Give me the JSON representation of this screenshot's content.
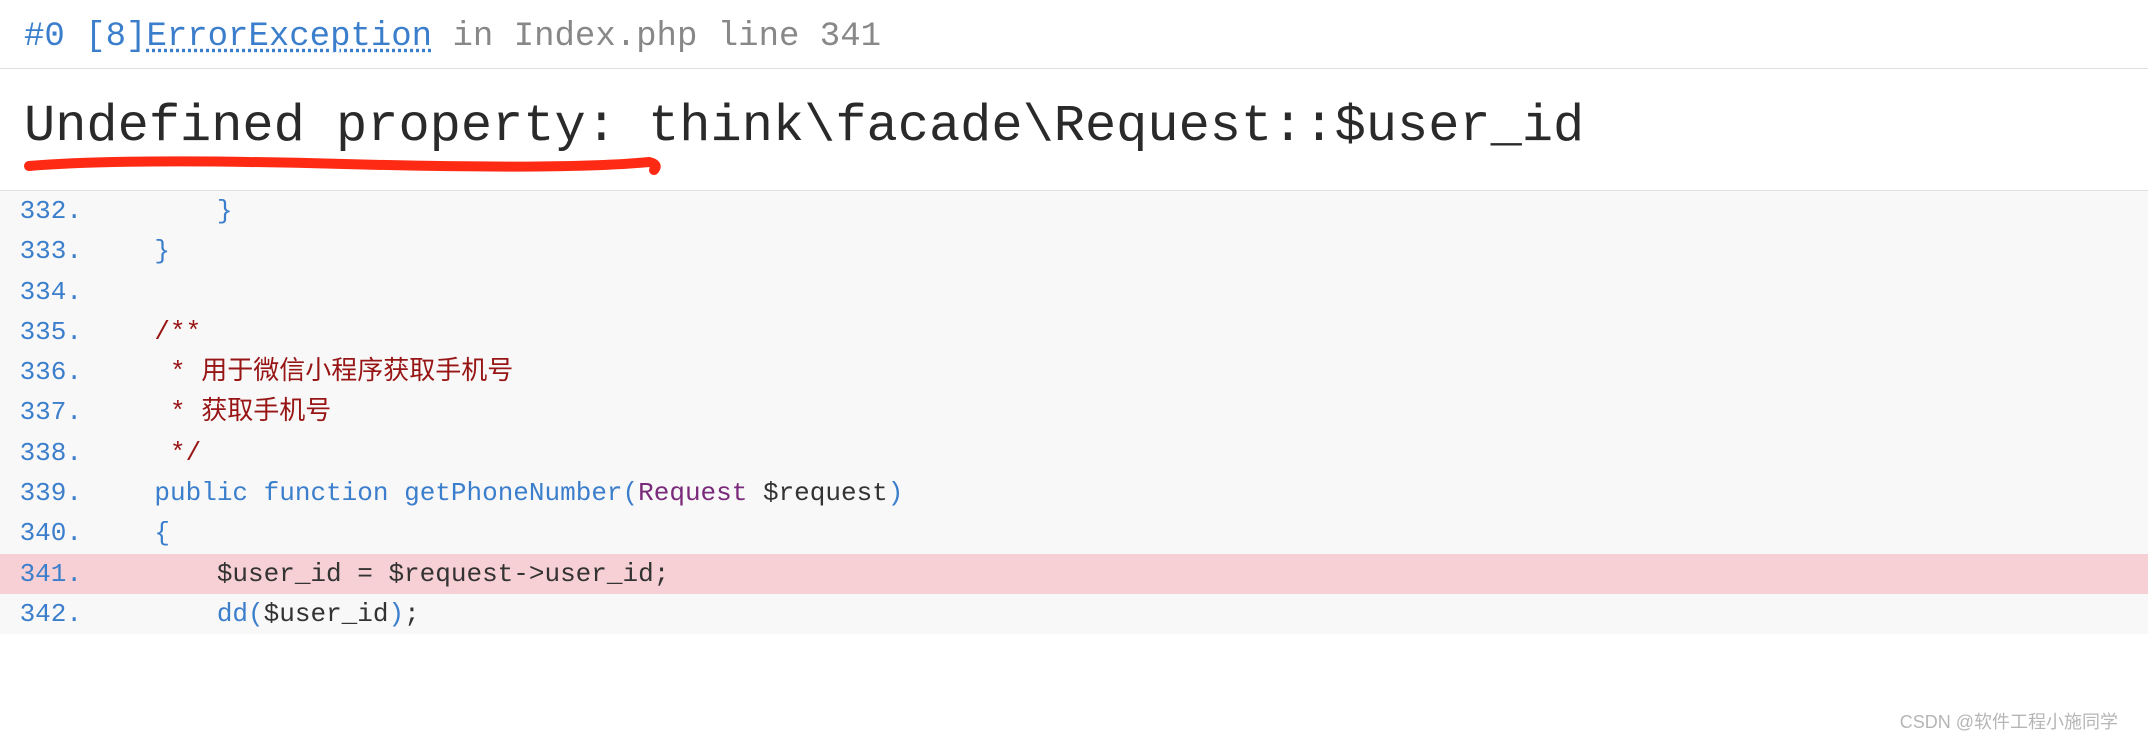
{
  "header": {
    "frame": "#0",
    "error_code_bracket_open": "[",
    "error_code": "8",
    "error_code_bracket_close": "]",
    "error_name": "ErrorException",
    "in": "in",
    "file": "Index.php",
    "line_word": "line",
    "line_number": "341"
  },
  "message": "Undefined property: think\\facade\\Request::$user_id",
  "code": {
    "lines": [
      {
        "n": "332.",
        "html": [
          {
            "c": "brace",
            "t": "        }"
          }
        ]
      },
      {
        "n": "333.",
        "html": [
          {
            "c": "brace",
            "t": "    }"
          }
        ]
      },
      {
        "n": "334.",
        "html": [
          {
            "c": "plain",
            "t": ""
          }
        ]
      },
      {
        "n": "335.",
        "html": [
          {
            "c": "comment",
            "t": "    /**"
          }
        ]
      },
      {
        "n": "336.",
        "html": [
          {
            "c": "comment",
            "t": "     * 用于微信小程序获取手机号"
          }
        ]
      },
      {
        "n": "337.",
        "html": [
          {
            "c": "comment",
            "t": "     * 获取手机号"
          }
        ]
      },
      {
        "n": "338.",
        "html": [
          {
            "c": "comment",
            "t": "     */"
          }
        ]
      },
      {
        "n": "339.",
        "html": [
          {
            "c": "plain",
            "t": "    "
          },
          {
            "c": "kw",
            "t": "public"
          },
          {
            "c": "plain",
            "t": " "
          },
          {
            "c": "kw",
            "t": "function"
          },
          {
            "c": "plain",
            "t": " "
          },
          {
            "c": "fn",
            "t": "getPhoneNumber"
          },
          {
            "c": "sym",
            "t": "("
          },
          {
            "c": "cls",
            "t": "Request"
          },
          {
            "c": "plain",
            "t": " $request"
          },
          {
            "c": "sym",
            "t": ")"
          }
        ]
      },
      {
        "n": "340.",
        "html": [
          {
            "c": "brace",
            "t": "    {"
          }
        ]
      },
      {
        "n": "341.",
        "highlight": true,
        "html": [
          {
            "c": "plain",
            "t": "        $user_id = $request->user_id;"
          }
        ]
      },
      {
        "n": "342.",
        "html": [
          {
            "c": "plain",
            "t": "        "
          },
          {
            "c": "fn",
            "t": "dd"
          },
          {
            "c": "sym",
            "t": "("
          },
          {
            "c": "plain",
            "t": "$user_id"
          },
          {
            "c": "sym",
            "t": ")"
          },
          {
            "c": "plain",
            "t": ";"
          }
        ]
      }
    ]
  },
  "watermark": "CSDN @软件工程小施同学"
}
